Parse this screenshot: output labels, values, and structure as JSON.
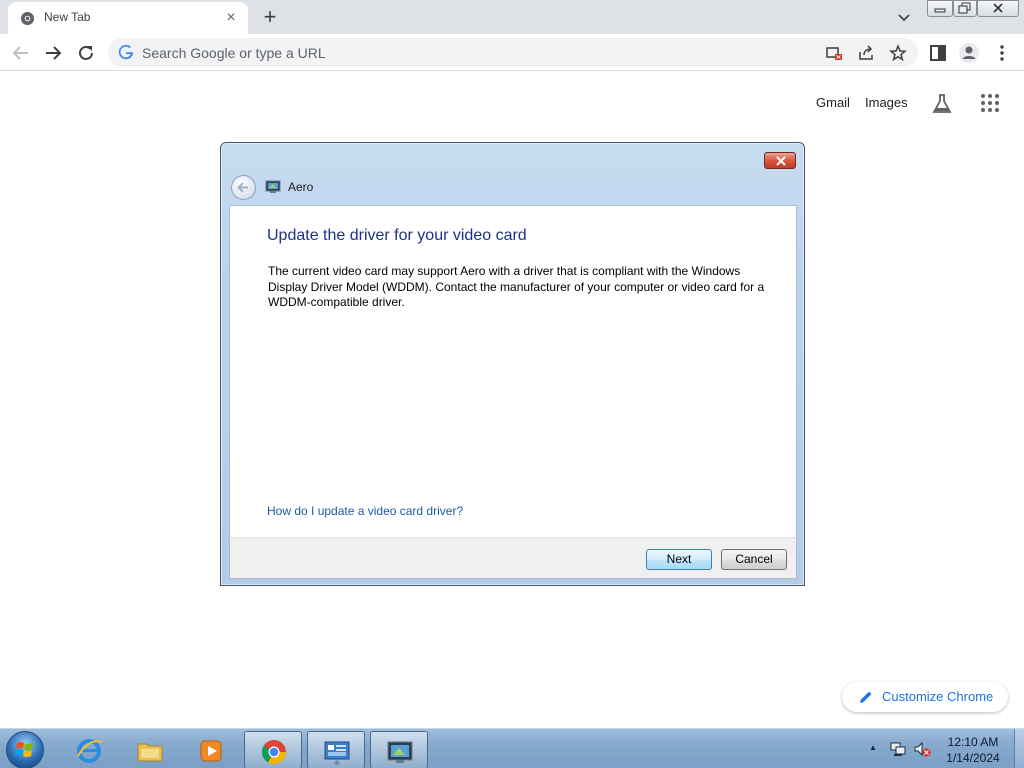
{
  "browser": {
    "tab_title": "New Tab",
    "omnibox_placeholder": "Search Google or type a URL"
  },
  "ntp": {
    "gmail": "Gmail",
    "images": "Images",
    "customize": "Customize Chrome"
  },
  "dialog": {
    "window_title": "Aero",
    "heading": "Update the driver for your video card",
    "body": "The current video card may support Aero with a driver that is compliant with the Windows Display Driver Model (WDDM).  Contact the manufacturer of your computer or video card for a WDDM-compatible driver.",
    "help_link": "How do I update a video card driver?",
    "next_label": "Next",
    "cancel_label": "Cancel"
  },
  "taskbar": {
    "clock_time": "12:10 AM",
    "clock_date": "1/14/2024",
    "items": [
      "internet-explorer",
      "file-explorer",
      "media-player",
      "chrome",
      "control-panel",
      "aero-troubleshooter"
    ]
  },
  "colors": {
    "link_blue": "#1a73e8",
    "dialog_heading": "#1e3287"
  }
}
